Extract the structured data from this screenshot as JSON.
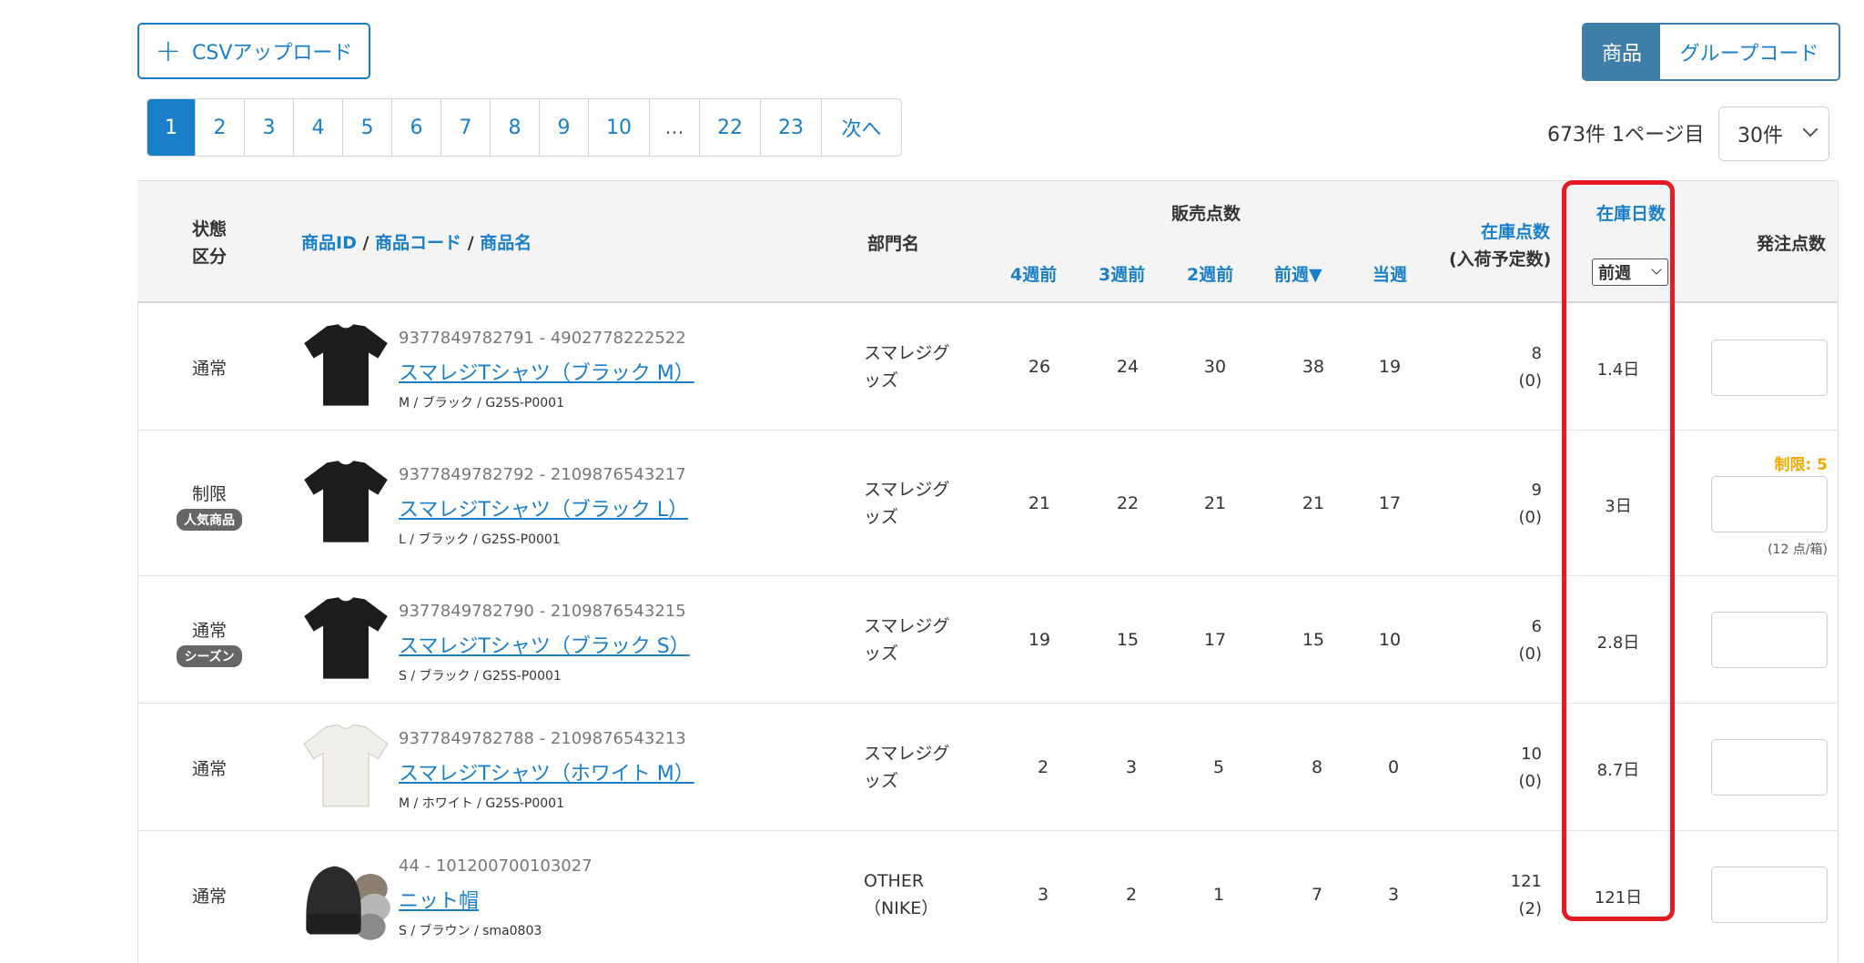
{
  "toolbar": {
    "csv_upload_label": "CSVアップロード"
  },
  "pagination": {
    "pages": [
      "1",
      "2",
      "3",
      "4",
      "5",
      "6",
      "7",
      "8",
      "9",
      "10",
      "...",
      "22",
      "23"
    ],
    "next_label": "次へ",
    "active": "1"
  },
  "view_toggle": {
    "product": "商品",
    "group_code": "グループコード"
  },
  "summary": {
    "count_text": "673件 1ページ目",
    "per_page": "30件"
  },
  "table": {
    "headers": {
      "status": [
        "状態",
        "区分"
      ],
      "product_id": "商品ID",
      "product_code": "商品コード",
      "product_name": "商品名",
      "department": "部門名",
      "sales_qty": "販売点数",
      "weeks": [
        "4週前",
        "3週前",
        "2週前",
        "前週▼",
        "当週"
      ],
      "stock_qty": "在庫点数",
      "stock_sub": "(入荷予定数)",
      "stock_days": "在庫日数",
      "stock_days_select": "前週",
      "order_qty": "発注点数"
    },
    "rows": [
      {
        "status": "通常",
        "badge": "",
        "ids": "9377849782791 - 4902778222522",
        "name": "スマレジTシャツ（ブラック M）",
        "meta": "M / ブラック / G25S-P0001",
        "dept1": "スマレジグ",
        "dept2": "ッズ",
        "sales": [
          "26",
          "24",
          "30",
          "38",
          "19"
        ],
        "stock": "8",
        "incoming": "(0)",
        "days": "1.4日",
        "limit": "",
        "per_box": ""
      },
      {
        "status": "制限",
        "badge": "人気商品",
        "ids": "9377849782792 - 2109876543217",
        "name": "スマレジTシャツ（ブラック L）",
        "meta": "L / ブラック / G25S-P0001",
        "dept1": "スマレジグ",
        "dept2": "ッズ",
        "sales": [
          "21",
          "22",
          "21",
          "21",
          "17"
        ],
        "stock": "9",
        "incoming": "(0)",
        "days": "3日",
        "limit": "制限: 5",
        "per_box": "(12 点/箱)"
      },
      {
        "status": "通常",
        "badge": "シーズン",
        "ids": "9377849782790 - 2109876543215",
        "name": "スマレジTシャツ（ブラック S）",
        "meta": "S / ブラック / G25S-P0001",
        "dept1": "スマレジグ",
        "dept2": "ッズ",
        "sales": [
          "19",
          "15",
          "17",
          "15",
          "10"
        ],
        "stock": "6",
        "incoming": "(0)",
        "days": "2.8日",
        "limit": "",
        "per_box": ""
      },
      {
        "status": "通常",
        "badge": "",
        "ids": "9377849782788 - 2109876543213",
        "name": "スマレジTシャツ（ホワイト M）",
        "meta": "M / ホワイト / G25S-P0001",
        "dept1": "スマレジグ",
        "dept2": "ッズ",
        "sales": [
          "2",
          "3",
          "5",
          "8",
          "0"
        ],
        "stock": "10",
        "incoming": "(0)",
        "days": "8.7日",
        "limit": "",
        "per_box": ""
      },
      {
        "status": "通常",
        "badge": "",
        "ids": "44 - 101200700103027",
        "name": "ニット帽",
        "meta": "S / ブラウン / sma0803",
        "dept1": "OTHER",
        "dept2": "（NIKE）",
        "sales": [
          "3",
          "2",
          "1",
          "7",
          "3"
        ],
        "stock": "121",
        "incoming": "(2)",
        "days": "121日",
        "limit": "",
        "per_box": ""
      }
    ]
  },
  "colors": {
    "accent": "#1a7fc9",
    "highlight": "#e51b23",
    "limit": "#f2a900",
    "toggle_active": "#3f7ea8"
  }
}
